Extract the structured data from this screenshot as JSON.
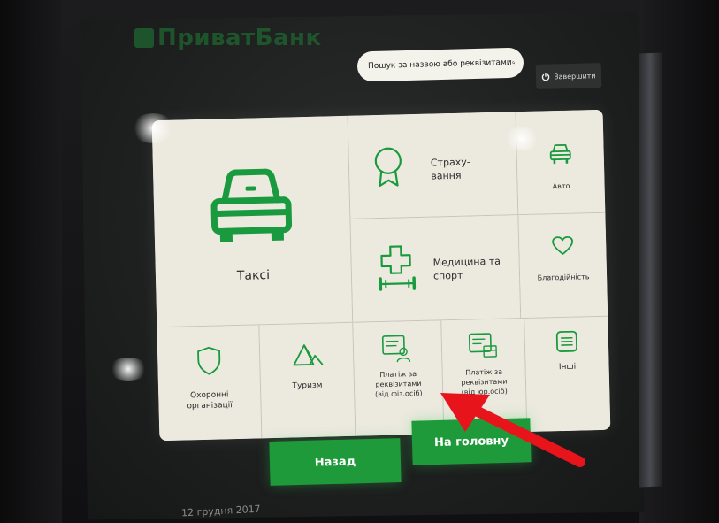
{
  "brand": {
    "name": "ПриватБанк"
  },
  "header": {
    "search_placeholder": "Пошук за назвою або реквізитами",
    "exit_label": "Завершити"
  },
  "tiles": {
    "taxi": "Таксі",
    "insurance_line1": "Страху-",
    "insurance_line2": "вання",
    "auto": "Авто",
    "medicine_line1": "Медицина та",
    "medicine_line2": "спорт",
    "charity": "Благодійність",
    "security_line1": "Охоронні",
    "security_line2": "організації",
    "tourism": "Туризм",
    "phys_line1": "Платіж за",
    "phys_line2": "реквізитами",
    "phys_line3": "(від фіз.осіб)",
    "jur_line1": "Платіж за",
    "jur_line2": "реквізитами",
    "jur_line3": "(від юр.осіб)",
    "other": "Інші"
  },
  "footer": {
    "back_label": "Назад",
    "home_label": "На головну",
    "date": "12 грудня 2017"
  },
  "colors": {
    "accent_green": "#1a9a3e",
    "button_green": "#1f9a3a",
    "arrow_red": "#e8141c"
  }
}
